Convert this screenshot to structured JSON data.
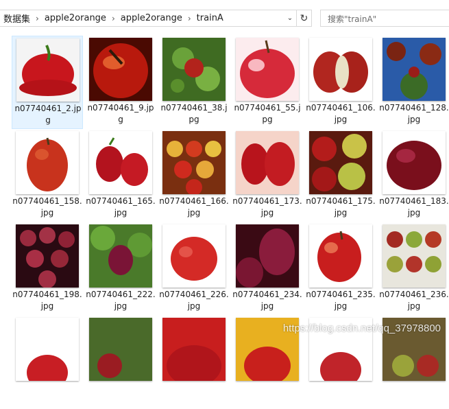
{
  "breadcrumb": {
    "items": [
      "数据集",
      "apple2orange",
      "apple2orange",
      "trainA"
    ]
  },
  "search": {
    "placeholder": "搜索\"trainA\""
  },
  "files": [
    {
      "line1": "n07740461_2.jp",
      "line2": "g"
    },
    {
      "line1": "n07740461_9.jp",
      "line2": "g"
    },
    {
      "line1": "n07740461_38.j",
      "line2": "pg"
    },
    {
      "line1": "n07740461_55.j",
      "line2": "pg"
    },
    {
      "line1": "n07740461_106.",
      "line2": "jpg"
    },
    {
      "line1": "n07740461_128.",
      "line2": "jpg"
    },
    {
      "line1": "n07740461_158.",
      "line2": "jpg"
    },
    {
      "line1": "n07740461_165.",
      "line2": "jpg"
    },
    {
      "line1": "n07740461_166.",
      "line2": "jpg"
    },
    {
      "line1": "n07740461_173.",
      "line2": "jpg"
    },
    {
      "line1": "n07740461_175.",
      "line2": "jpg"
    },
    {
      "line1": "n07740461_183.",
      "line2": "jpg"
    },
    {
      "line1": "n07740461_198.",
      "line2": "jpg"
    },
    {
      "line1": "n07740461_222.",
      "line2": "jpg"
    },
    {
      "line1": "n07740461_226.",
      "line2": "jpg"
    },
    {
      "line1": "n07740461_234.",
      "line2": "jpg"
    },
    {
      "line1": "n07740461_235.",
      "line2": "jpg"
    },
    {
      "line1": "n07740461_236.",
      "line2": "jpg"
    },
    {
      "line1": "",
      "line2": ""
    },
    {
      "line1": "",
      "line2": ""
    },
    {
      "line1": "",
      "line2": ""
    },
    {
      "line1": "",
      "line2": ""
    },
    {
      "line1": "",
      "line2": ""
    },
    {
      "line1": "",
      "line2": ""
    }
  ],
  "watermark": "https://blog.csdn.net/qq_37978800",
  "colors": {
    "selected_bg": "#e5f3ff",
    "apple_red": "#c8161d"
  }
}
